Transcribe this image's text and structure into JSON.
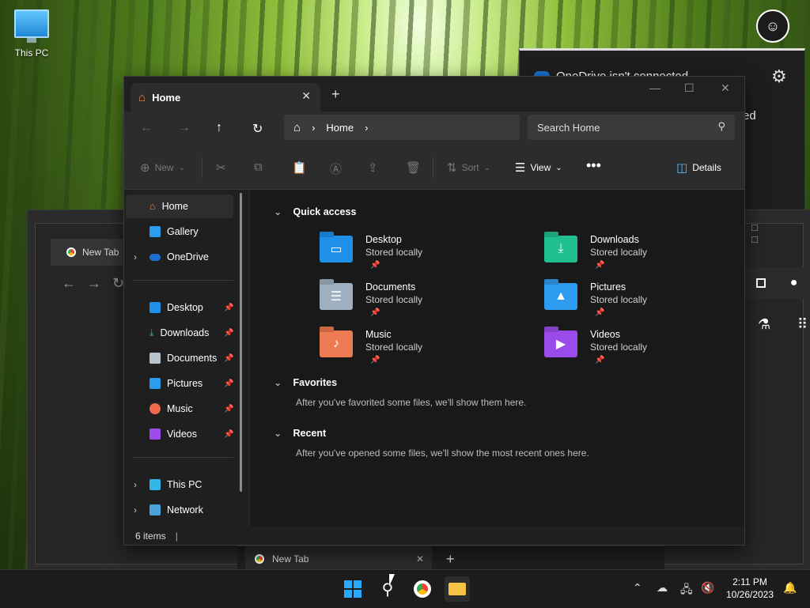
{
  "desktop": {
    "icons": [
      {
        "label": "This PC",
        "icon": "this-pc-icon"
      }
    ]
  },
  "onedrive_panel": {
    "title": "OneDrive isn't connected",
    "partial_text": "ed"
  },
  "background_chrome": {
    "tab_label": "New Tab",
    "bottom_tab_label": "New Tab"
  },
  "explorer": {
    "tab": {
      "title": "Home",
      "icon": "home-icon"
    },
    "address": {
      "crumbs": [
        "Home"
      ]
    },
    "search": {
      "placeholder": "Search Home"
    },
    "toolbar": {
      "new_label": "New",
      "sort_label": "Sort",
      "view_label": "View",
      "details_label": "Details"
    },
    "nav": {
      "top": [
        {
          "label": "Home",
          "selected": true,
          "icon": "home-icon"
        },
        {
          "label": "Gallery",
          "icon": "gallery-icon"
        },
        {
          "label": "OneDrive",
          "icon": "onedrive-icon",
          "expandable": true
        }
      ],
      "pinned": [
        {
          "label": "Desktop",
          "icon": "desktop-icon",
          "color": "#1e90e8"
        },
        {
          "label": "Downloads",
          "icon": "downloads-icon",
          "color": "#27c08a"
        },
        {
          "label": "Documents",
          "icon": "documents-icon",
          "color": "#b7c3cf"
        },
        {
          "label": "Pictures",
          "icon": "pictures-icon",
          "color": "#2d9cf0"
        },
        {
          "label": "Music",
          "icon": "music-icon",
          "color": "#f06a4e"
        },
        {
          "label": "Videos",
          "icon": "videos-icon",
          "color": "#9a4bea"
        }
      ],
      "bottom": [
        {
          "label": "This PC",
          "icon": "this-pc-icon",
          "expandable": true
        },
        {
          "label": "Network",
          "icon": "network-icon",
          "expandable": true
        }
      ]
    },
    "sections": {
      "quick_access": {
        "title": "Quick access",
        "items": [
          {
            "name": "Desktop",
            "sub": "Stored locally",
            "color": "#1e90e8"
          },
          {
            "name": "Downloads",
            "sub": "Stored locally",
            "color": "#1fbf8f"
          },
          {
            "name": "Documents",
            "sub": "Stored locally",
            "color": "#9fb0c0"
          },
          {
            "name": "Pictures",
            "sub": "Stored locally",
            "color": "#2d9cf0"
          },
          {
            "name": "Music",
            "sub": "Stored locally",
            "color": "#ee7a52"
          },
          {
            "name": "Videos",
            "sub": "Stored locally",
            "color": "#9a4bea"
          }
        ]
      },
      "favorites": {
        "title": "Favorites",
        "note": "After you've favorited some files, we'll show them here."
      },
      "recent": {
        "title": "Recent",
        "note": "After you've opened some files, we'll show the most recent ones here."
      }
    },
    "status": {
      "items": "6 items"
    }
  },
  "taskbar": {
    "clock_time": "2:11 PM",
    "clock_date": "10/26/2023"
  }
}
